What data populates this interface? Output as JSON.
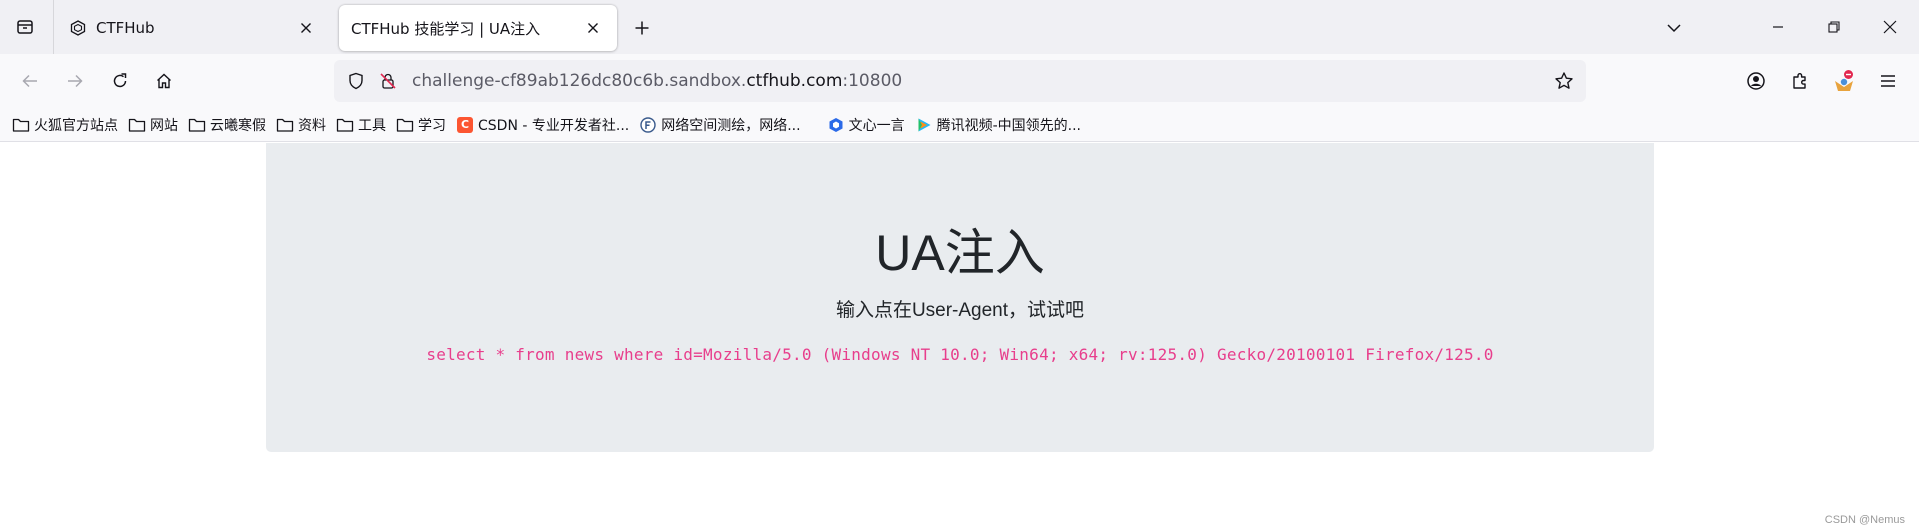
{
  "browser": {
    "tabs": [
      {
        "title": "CTFHub",
        "active": false
      },
      {
        "title": "CTFHub 技能学习 | UA注入",
        "active": true
      }
    ],
    "url": {
      "prefix": "challenge-cf89ab126dc80c6b.sandbox.",
      "host": "ctfhub.com",
      "port": ":10800"
    },
    "bookmarks": [
      {
        "label": "火狐官方站点",
        "icon": "folder-icon"
      },
      {
        "label": "网站",
        "icon": "folder-icon"
      },
      {
        "label": "云曦寒假",
        "icon": "folder-icon"
      },
      {
        "label": "资料",
        "icon": "folder-icon"
      },
      {
        "label": "工具",
        "icon": "folder-icon"
      },
      {
        "label": "学习",
        "icon": "folder-icon"
      },
      {
        "label": "CSDN - 专业开发者社...",
        "icon": "csdn-icon"
      },
      {
        "label": "网络空间测绘，网络...",
        "icon": "fofa-icon"
      },
      {
        "label": "文心一言",
        "icon": "wenxin-icon"
      },
      {
        "label": "腾讯视频-中国领先的...",
        "icon": "tencent-video-icon"
      }
    ],
    "colors": {
      "tabstrip": "#f0f0f4",
      "toolbar": "#f9f9fb",
      "csdn": "#fc5531",
      "wenxin": "#2b6ae8"
    }
  },
  "page": {
    "heading": "UA注入",
    "lead": "输入点在User-Agent，试试吧",
    "query": "select * from news where id=Mozilla/5.0 (Windows NT 10.0; Win64; x64; rv:125.0) Gecko/20100101 Firefox/125.0",
    "colors": {
      "jumbotron": "#e9ecef",
      "code": "#e83e8c"
    }
  },
  "watermark": "CSDN @Nemus"
}
